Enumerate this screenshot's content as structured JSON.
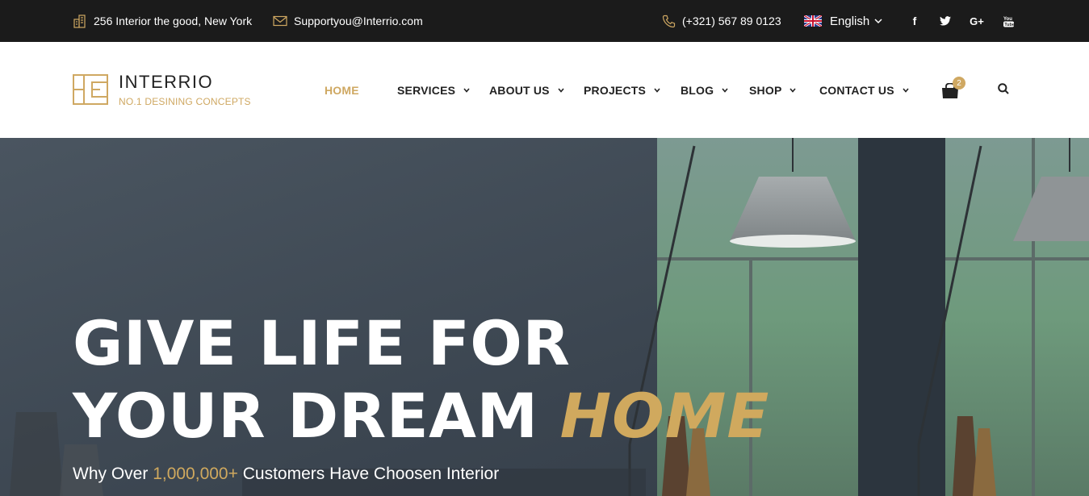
{
  "topbar": {
    "address": "256 Interior the good, New York",
    "email": "Supportyou@Interrio.com",
    "phone": "(+321) 567 89 0123",
    "language": "English",
    "social": [
      "facebook-icon",
      "twitter-icon",
      "google-plus-icon",
      "youtube-icon"
    ]
  },
  "brand": {
    "name": "INTERRIO",
    "tagline": "NO.1 DESINING CONCEPTS"
  },
  "nav": {
    "items": [
      {
        "label": "HOME",
        "active": true
      },
      {
        "label": "SERVICES",
        "active": false
      },
      {
        "label": "ABOUT US",
        "active": false
      },
      {
        "label": "PROJECTS",
        "active": false
      },
      {
        "label": "BLOG",
        "active": false
      },
      {
        "label": "SHOP",
        "active": false
      },
      {
        "label": "CONTACT US",
        "active": false
      }
    ],
    "cart_count": "2"
  },
  "hero": {
    "title_line1": "GIVE LIFE FOR",
    "title_line2": "YOUR DREAM",
    "title_accent": "HOME",
    "subtitle_pre": "Why Over",
    "subtitle_number": "1,000,000+",
    "subtitle_post": "Customers Have Choosen Interior"
  },
  "colors": {
    "accent": "#cfa862",
    "topbar_bg": "#1b1b1b",
    "nav_text": "#222222"
  }
}
